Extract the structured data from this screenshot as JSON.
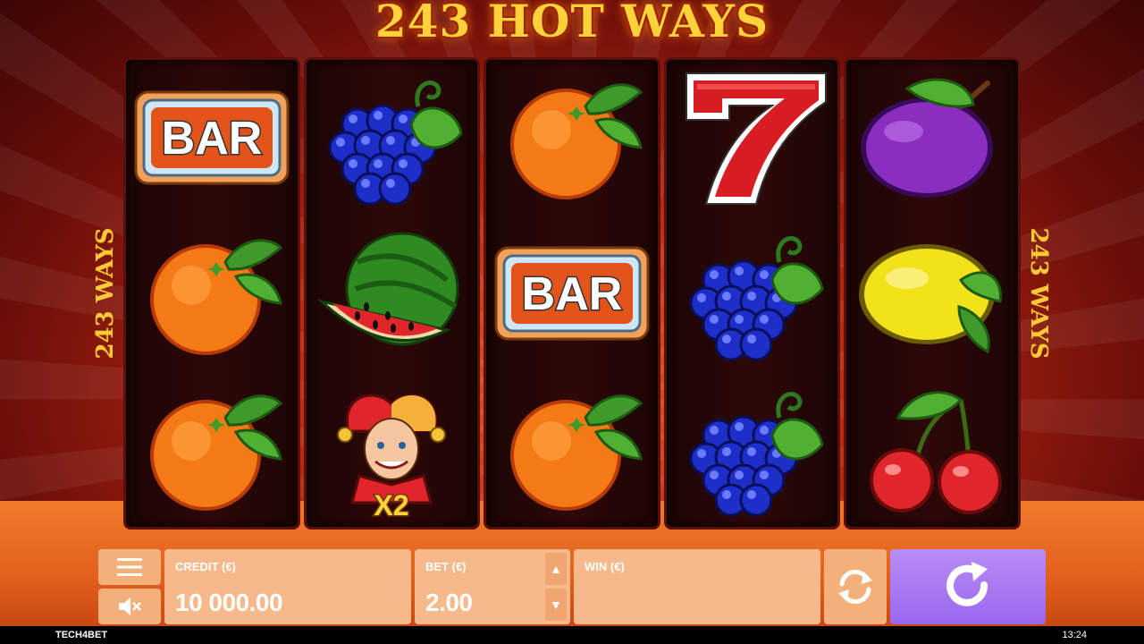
{
  "game": {
    "title": "243 HOT WAYS",
    "side_label": "243 WAYS"
  },
  "reels": [
    [
      "bar",
      "orange",
      "orange"
    ],
    [
      "grapes",
      "watermelon",
      "joker"
    ],
    [
      "orange",
      "bar",
      "orange"
    ],
    [
      "seven",
      "grapes",
      "grapes"
    ],
    [
      "plum",
      "lemon",
      "cherry"
    ]
  ],
  "symbols": {
    "bar_text": "BAR",
    "joker_multiplier": "X2"
  },
  "panel": {
    "credit_label": "CREDIT (€)",
    "credit_value": "10 000.00",
    "bet_label": "BET (€)",
    "bet_value": "2.00",
    "win_label": "WIN (€)",
    "win_value": ""
  },
  "statusbar": {
    "brand": "TECH4BET",
    "clock": "13:24"
  },
  "colors": {
    "accent_spin": "#9a67ee",
    "panel_field": "#f6b98b",
    "title_gold": "#ffd23a"
  }
}
